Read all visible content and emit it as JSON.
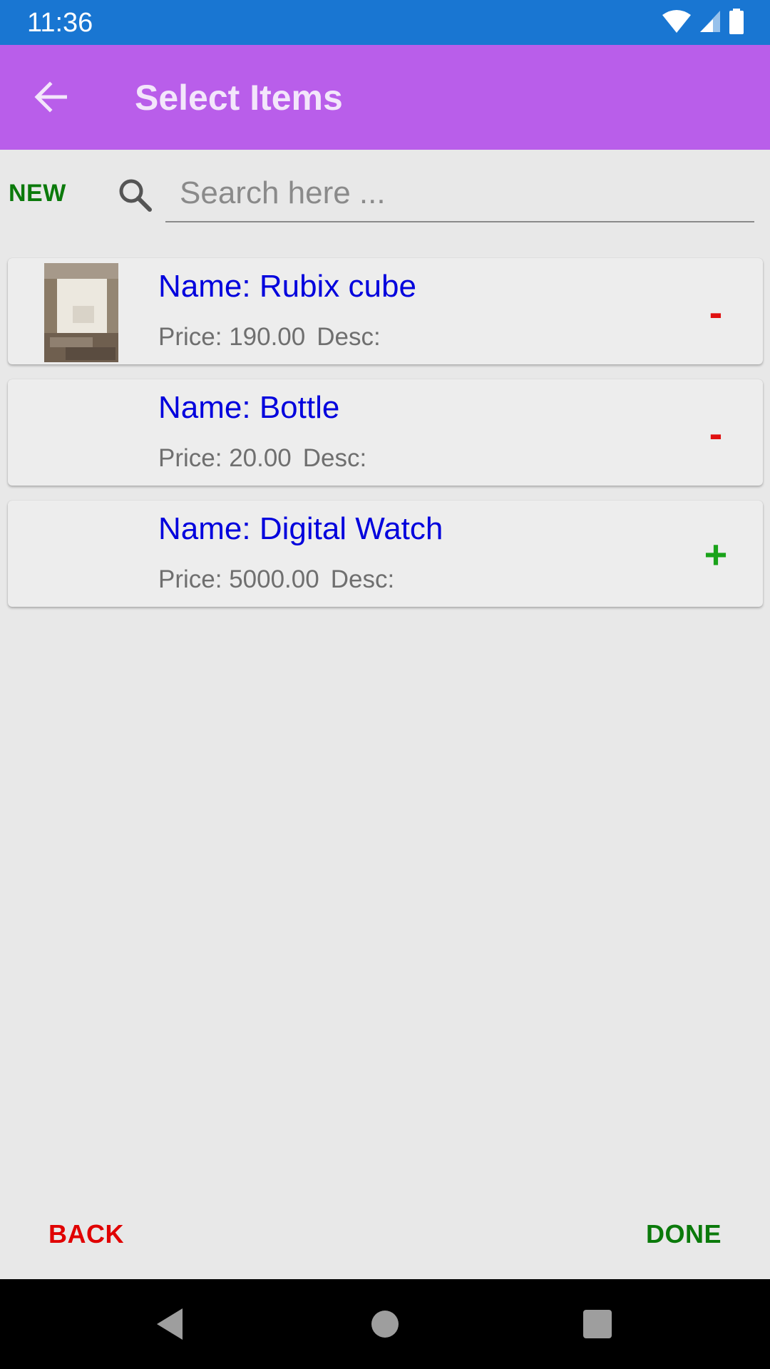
{
  "status_bar": {
    "time": "11:36",
    "icons": [
      "wifi-icon",
      "cell-signal-icon",
      "battery-icon"
    ],
    "color": "#1976d2"
  },
  "app_bar": {
    "title": "Select Items",
    "back_icon": "arrow-left-icon",
    "color": "#b95eea"
  },
  "search": {
    "new_label": "NEW",
    "placeholder": "Search here ...",
    "value": "",
    "icon": "search-icon"
  },
  "items": [
    {
      "name": "Name: Rubix cube",
      "price": "Price: 190.00",
      "desc": "Desc:",
      "action": "-",
      "has_image": true
    },
    {
      "name": "Name: Bottle",
      "price": "Price: 20.00",
      "desc": "Desc:",
      "action": "-",
      "has_image": false
    },
    {
      "name": "Name: Digital Watch",
      "price": "Price: 5000.00",
      "desc": "Desc:",
      "action": "+",
      "has_image": false
    }
  ],
  "footer": {
    "back_label": "BACK",
    "done_label": "DONE"
  },
  "nav_bar": {
    "icons": [
      "nav-back-icon",
      "nav-home-icon",
      "nav-recents-icon"
    ]
  },
  "colors": {
    "item_name": "#0000dd",
    "remove": "#e01010",
    "add": "#1aa31a",
    "positive_action": "#0b7a0b",
    "negative_action": "#e00000"
  }
}
